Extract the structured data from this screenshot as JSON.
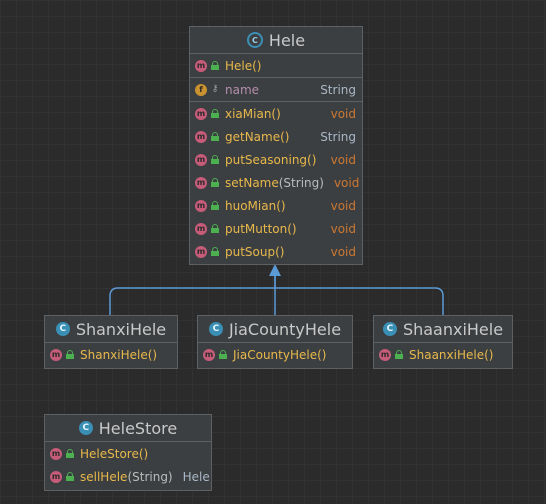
{
  "hele": {
    "icon": "abstract-class-icon",
    "title": "Hele",
    "constructor": {
      "name": "Hele()"
    },
    "field": {
      "name": "name",
      "type": "String"
    },
    "methods": [
      {
        "name": "xiaMian()",
        "param": "",
        "type": "void"
      },
      {
        "name": "getName()",
        "param": "",
        "type": "String"
      },
      {
        "name": "putSeasoning()",
        "param": "",
        "type": "void"
      },
      {
        "name": "setName",
        "param": "(String)",
        "type": "void"
      },
      {
        "name": "huoMian()",
        "param": "",
        "type": "void"
      },
      {
        "name": "putMutton()",
        "param": "",
        "type": "void"
      },
      {
        "name": "putSoup()",
        "param": "",
        "type": "void"
      }
    ]
  },
  "shanxi": {
    "title": "ShanxiHele",
    "constructor": "ShanxiHele()"
  },
  "jiacounty": {
    "title": "JiaCountyHele",
    "constructor": "JiaCountyHele()"
  },
  "shaanxi": {
    "title": "ShaanxiHele",
    "constructor": "ShaanxiHele()"
  },
  "store": {
    "title": "HeleStore",
    "constructor": "HeleStore()",
    "method": {
      "name": "sellHele",
      "param": "(String)",
      "type": "Hele"
    }
  },
  "colors": {
    "edge": "#5b9bd5",
    "background": "#2b2b2b",
    "method_badge": "#c75c7a",
    "field_badge": "#c9922f",
    "class_badge": "#3a8fb5"
  }
}
